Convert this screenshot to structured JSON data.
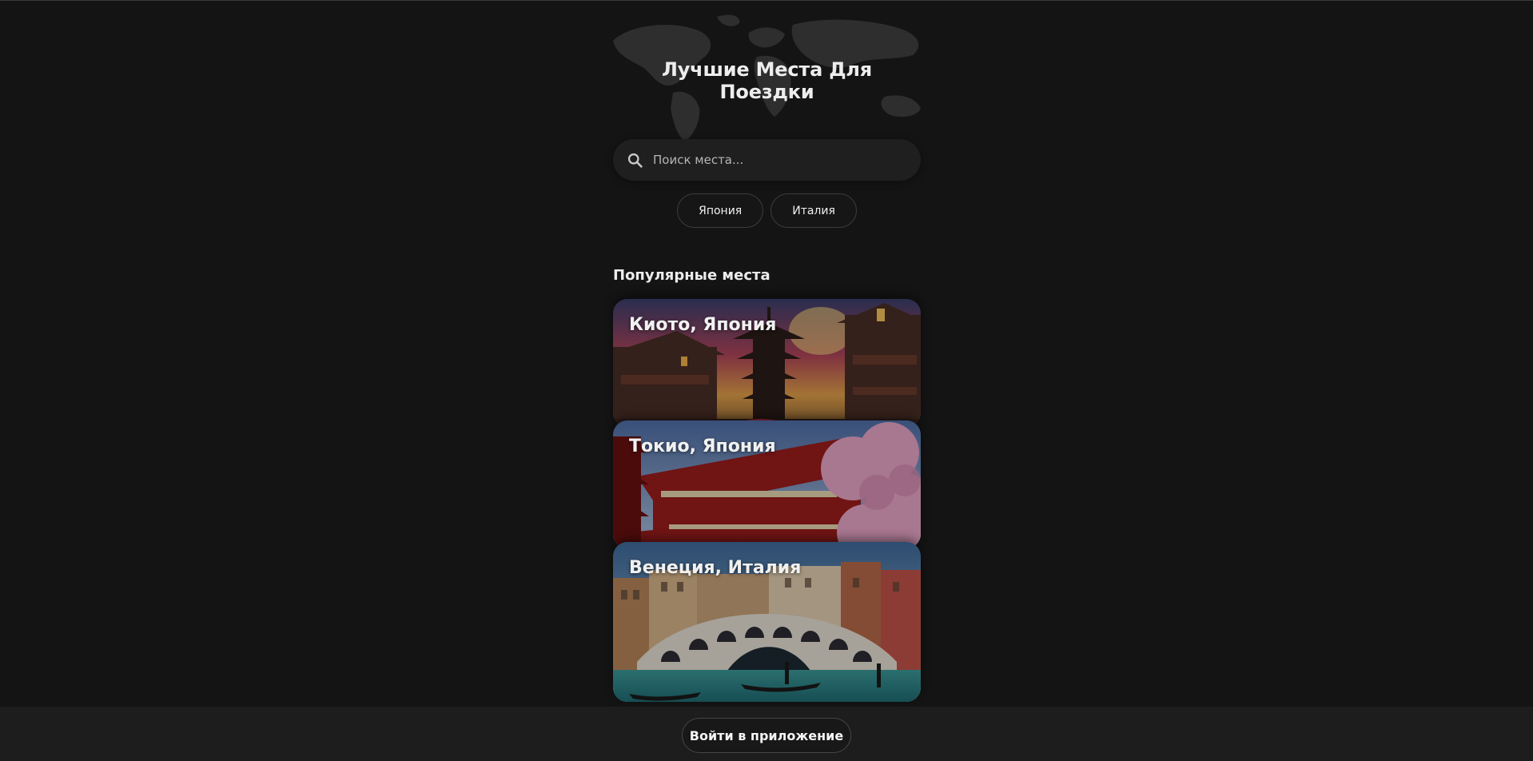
{
  "header": {
    "title": "Лучшие Места Для Поездки"
  },
  "search": {
    "placeholder": "Поиск места...",
    "icon": "search-icon"
  },
  "filters": [
    {
      "label": "Япония"
    },
    {
      "label": "Италия"
    }
  ],
  "popular": {
    "title": "Популярные места",
    "places": [
      {
        "name": "Киото, Япония"
      },
      {
        "name": "Токио, Япония"
      },
      {
        "name": "Венеция, Италия"
      }
    ]
  },
  "footer": {
    "login_label": "Войти в приложение"
  },
  "colors": {
    "background": "#141414",
    "surface": "#1f1f1f",
    "footer": "#1d1d1d",
    "text": "#e6e6e6"
  }
}
